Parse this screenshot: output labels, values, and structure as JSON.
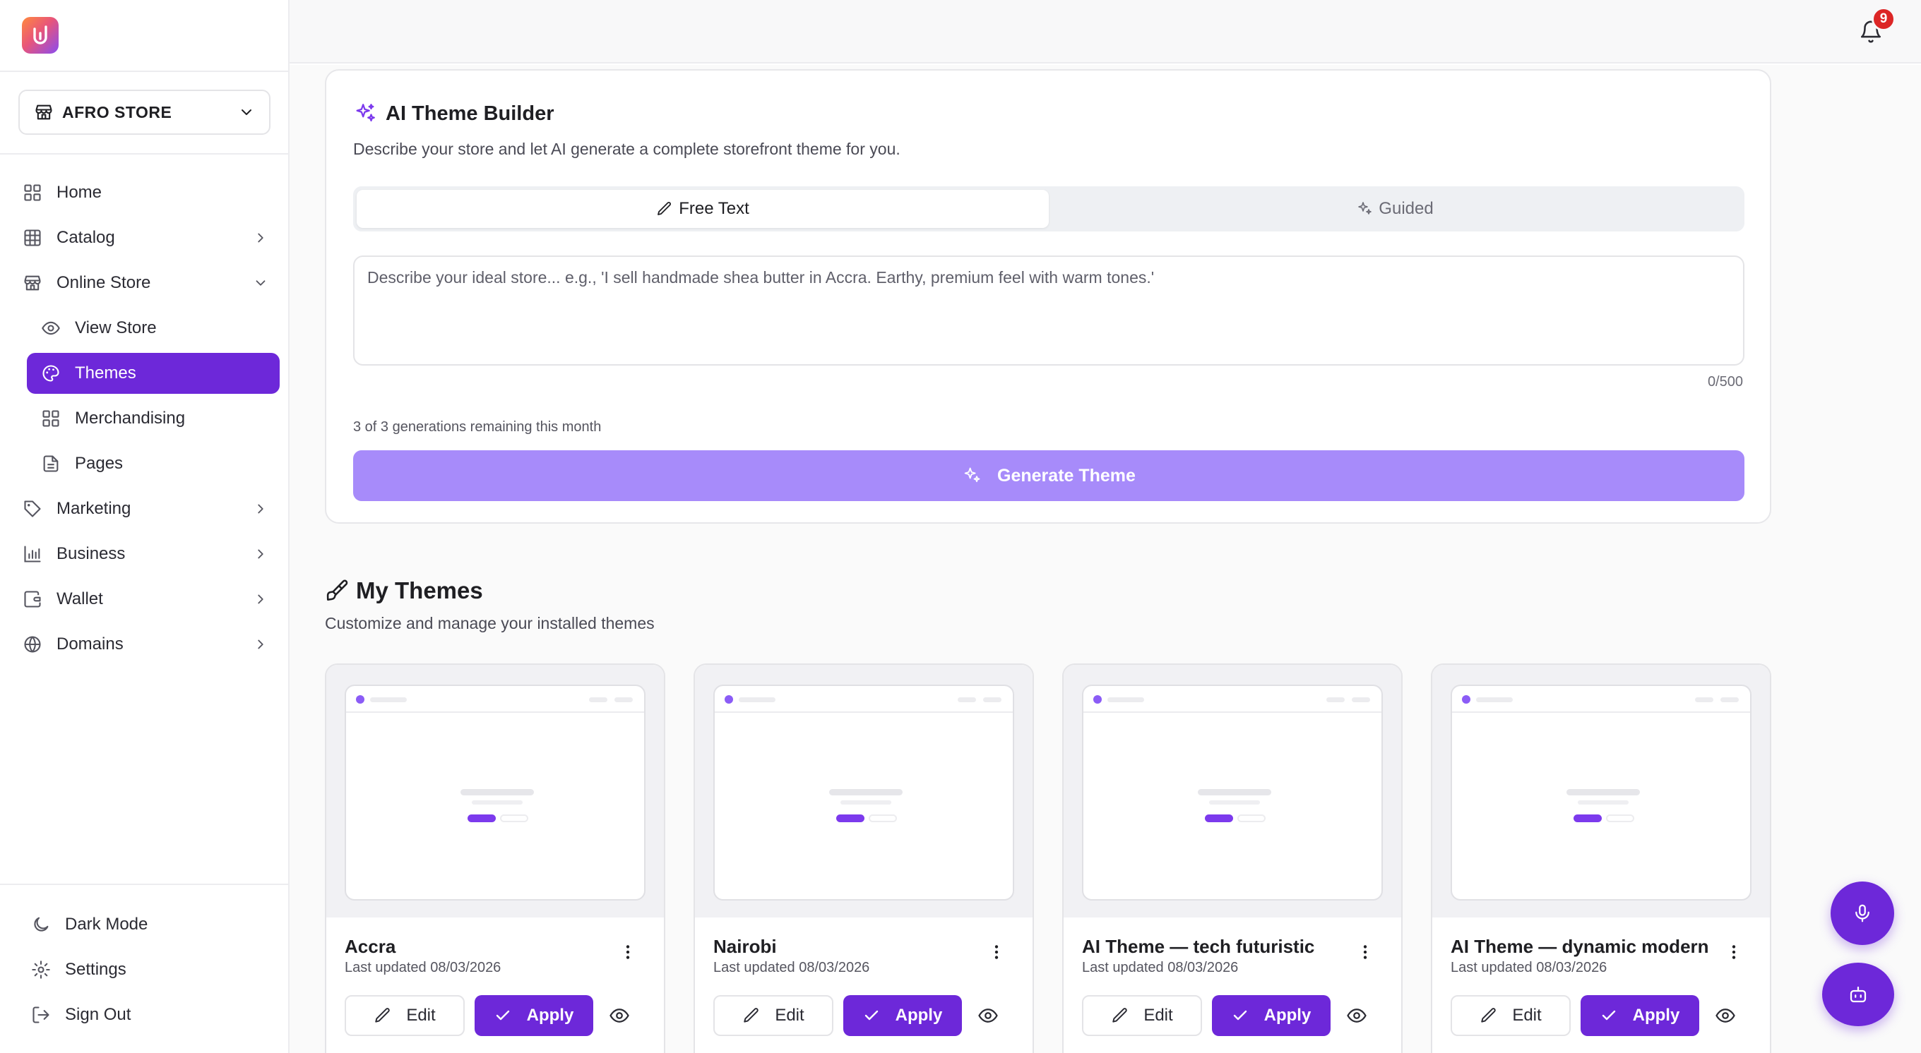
{
  "sidebar": {
    "store": {
      "name": "AFRO STORE"
    },
    "nav": [
      {
        "label": "Home",
        "icon": "grid-icon"
      },
      {
        "label": "Catalog",
        "icon": "table-icon"
      },
      {
        "label": "Online Store",
        "icon": "store-icon"
      },
      {
        "label": "View Store",
        "icon": "eye-icon"
      },
      {
        "label": "Themes",
        "icon": "palette-icon",
        "active": true
      },
      {
        "label": "Merchandising",
        "icon": "grid-icon"
      },
      {
        "label": "Pages",
        "icon": "file-icon"
      },
      {
        "label": "Marketing",
        "icon": "tag-icon"
      },
      {
        "label": "Business",
        "icon": "bar-chart-icon"
      },
      {
        "label": "Wallet",
        "icon": "wallet-icon"
      },
      {
        "label": "Domains",
        "icon": "globe-icon"
      }
    ],
    "bottom": [
      {
        "label": "Dark Mode",
        "icon": "moon-icon"
      },
      {
        "label": "Settings",
        "icon": "gear-icon"
      },
      {
        "label": "Sign Out",
        "icon": "logout-icon"
      }
    ]
  },
  "topbar": {
    "notifications_count": "9"
  },
  "ai_builder": {
    "title": "AI Theme Builder",
    "description": "Describe your store and let AI generate a complete storefront theme for you.",
    "tabs": [
      "Free Text",
      "Guided"
    ],
    "active_tab": "Free Text",
    "prompt_placeholder": "Describe your ideal store... e.g., 'I sell handmade shea butter in Accra. Earthy, premium feel with warm tones.'",
    "prompt_value": "",
    "char_count": "0/500",
    "remaining": "3 of 3 generations remaining this month",
    "generate_label": "Generate Theme"
  },
  "my_themes": {
    "title": "My Themes",
    "description": "Customize and manage your installed themes",
    "edit_label": "Edit",
    "apply_label": "Apply",
    "themes": [
      {
        "name": "Accra",
        "updated": "Last updated 08/03/2026"
      },
      {
        "name": "Nairobi",
        "updated": "Last updated 08/03/2026"
      },
      {
        "name": "AI Theme — tech futuristic",
        "updated": "Last updated 08/03/2026"
      },
      {
        "name": "AI Theme — dynamic modern",
        "updated": "Last updated 08/03/2026"
      }
    ]
  },
  "colors": {
    "accent": "#6d28d9",
    "accent_light": "#a78bfa",
    "badge": "#dc2626"
  }
}
